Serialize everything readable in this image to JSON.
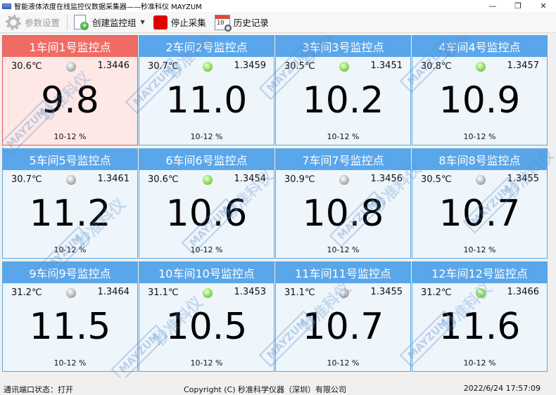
{
  "window": {
    "title": "智能液体浓度在线监控仪数据采集器——秒准科仪 MAYZUM",
    "controls": [
      "—",
      "❐",
      "✕"
    ]
  },
  "toolbar": {
    "settings_label": "参数设置",
    "create_group_label": "创建监控组",
    "stop_label": "停止采集",
    "history_label": "历史记录",
    "calendar_number": "10"
  },
  "cards": [
    {
      "title": "1车间1号监控点",
      "temp": "30.6℃",
      "aux": "1.3446",
      "value": "9.8",
      "range": "10-12 %",
      "lamp": "gray",
      "alarm": true
    },
    {
      "title": "2车间2号监控点",
      "temp": "30.7℃",
      "aux": "1.3459",
      "value": "11.0",
      "range": "10-12 %",
      "lamp": "green",
      "alarm": false
    },
    {
      "title": "3车间3号监控点",
      "temp": "30.5℃",
      "aux": "1.3451",
      "value": "10.2",
      "range": "10-12 %",
      "lamp": "green",
      "alarm": false
    },
    {
      "title": "4车间4号监控点",
      "temp": "30.8℃",
      "aux": "1.3457",
      "value": "10.9",
      "range": "10-12 %",
      "lamp": "green",
      "alarm": false
    },
    {
      "title": "5车间5号监控点",
      "temp": "30.7℃",
      "aux": "1.3461",
      "value": "11.2",
      "range": "10-12 %",
      "lamp": "gray",
      "alarm": false
    },
    {
      "title": "6车间6号监控点",
      "temp": "30.6℃",
      "aux": "1.3454",
      "value": "10.6",
      "range": "10-12 %",
      "lamp": "green",
      "alarm": false
    },
    {
      "title": "7车间7号监控点",
      "temp": "30.9℃",
      "aux": "1.3456",
      "value": "10.8",
      "range": "10-12 %",
      "lamp": "gray",
      "alarm": false
    },
    {
      "title": "8车间8号监控点",
      "temp": "30.5℃",
      "aux": "1.3455",
      "value": "10.7",
      "range": "10-12 %",
      "lamp": "gray",
      "alarm": false
    },
    {
      "title": "9车间9号监控点",
      "temp": "31.2℃",
      "aux": "1.3464",
      "value": "11.5",
      "range": "10-12 %",
      "lamp": "gray",
      "alarm": false
    },
    {
      "title": "10车间10号监控点",
      "temp": "31.1℃",
      "aux": "1.3453",
      "value": "10.5",
      "range": "10-12 %",
      "lamp": "green",
      "alarm": false
    },
    {
      "title": "11车间11号监控点",
      "temp": "31.1℃",
      "aux": "1.3455",
      "value": "10.7",
      "range": "10-12 %",
      "lamp": "gray",
      "alarm": false
    },
    {
      "title": "12车间12号监控点",
      "temp": "31.2℃",
      "aux": "1.3466",
      "value": "11.6",
      "range": "10-12 %",
      "lamp": "green",
      "alarm": false
    }
  ],
  "watermark": {
    "badge": "MAYZUM",
    "text": "秒准科仪"
  },
  "status": {
    "port_label": "通讯端口状态：",
    "port_value": "打开",
    "copyright": "Copyright (C) 秒准科学仪器（深圳）有限公司",
    "datetime": "2022/6/24 17:57:09"
  },
  "colors": {
    "card_header": "#5aa6ea",
    "card_border": "#5aa7e0",
    "alarm_header": "#ef6b64",
    "alarm_bg": "#fde8e6",
    "lamp_green": "#8fdc5b",
    "lamp_gray": "#b8b8b8",
    "stop_red": "#e00000"
  }
}
